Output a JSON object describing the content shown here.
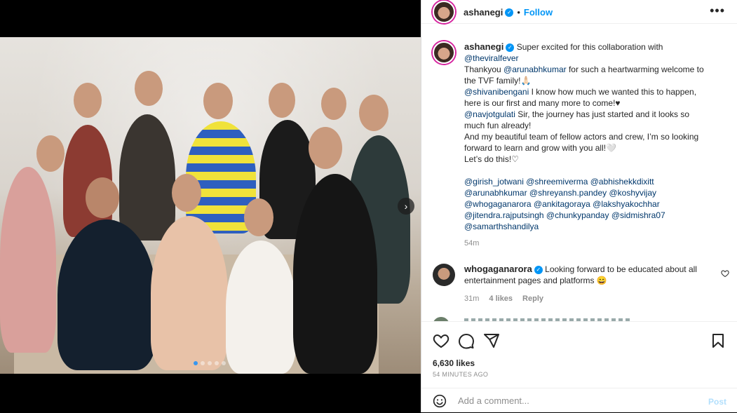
{
  "post": {
    "username": "ashanegi",
    "follow_label": "Follow",
    "more_label": "•••"
  },
  "caption": {
    "username": "ashanegi",
    "lines": [
      {
        "text": "Super excited for this collaboration with"
      },
      {
        "text": "@theviralfever",
        "mention": true
      },
      {
        "pre": "Thankyou ",
        "mention": "@arunabhkumar",
        "post": " for such a heartwarming welcome to"
      },
      {
        "text": "the TVF family!🙏🏻"
      },
      {
        "mention": "@shivanibengani",
        "post": " I know how much we wanted this to happen,"
      },
      {
        "text": "here is our first and many more to come!♥"
      },
      {
        "mention": "@navjotgulati",
        "post": " Sir, the journey has just started and it looks so"
      },
      {
        "text": "much fun already!"
      },
      {
        "text": "And my beautiful team of fellow actors and crew, I’m so looking"
      },
      {
        "text": "forward to learn and grow with you all!🤍"
      },
      {
        "text": "Let’s do this!♡"
      }
    ],
    "tags": [
      "@girish_jotwani @shreemiverma @abhishekkdixitt",
      "@arunabhkumar @shreyansh.pandey @koshyvijay",
      "@whogaganarora @ankitagoraya @lakshyakochhar",
      "@jitendra.rajputsingh @chunkypanday @sidmishra07",
      "@samarthshandilya"
    ],
    "time": "54m"
  },
  "comment": {
    "username": "whogaganarora",
    "text_line1": "Looking forward to be educated about all",
    "text_line2": "entertainment pages and platforms 😄",
    "time": "31m",
    "likes": "4 likes",
    "reply": "Reply"
  },
  "footer": {
    "likes": "6,630 likes",
    "ago": "54 MINUTES AGO",
    "comment_placeholder": "Add a comment...",
    "post_label": "Post"
  },
  "carousel": {
    "dots": 5,
    "active_index": 0
  },
  "colors": {
    "link": "#00376b",
    "follow": "#0095f6",
    "muted": "#8e8e8e"
  }
}
